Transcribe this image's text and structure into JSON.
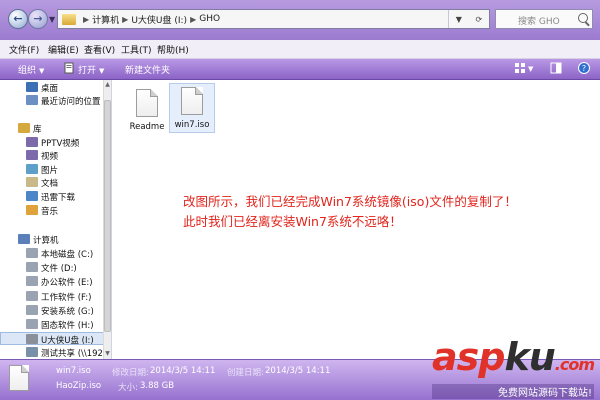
{
  "address": {
    "crumbs": [
      "计算机",
      "U大侠U盘 (I:)",
      "GHO"
    ]
  },
  "search": {
    "placeholder": "搜索 GHO"
  },
  "menu": [
    "文件(F)",
    "编辑(E)",
    "查看(V)",
    "工具(T)",
    "帮助(H)"
  ],
  "toolbar": {
    "organize": "组织",
    "open": "打开",
    "new_folder": "新建文件夹"
  },
  "nav": {
    "items": [
      {
        "label": "桌面",
        "icon": "desktop-icon"
      },
      {
        "label": "最近访问的位置",
        "icon": "recent-places-icon"
      },
      {
        "label": "库",
        "icon": "library-icon"
      },
      {
        "label": "PPTV视频",
        "icon": "video-library-icon"
      },
      {
        "label": "视频",
        "icon": "video-library-icon"
      },
      {
        "label": "图片",
        "icon": "pictures-library-icon"
      },
      {
        "label": "文档",
        "icon": "documents-library-icon"
      },
      {
        "label": "迅雷下载",
        "icon": "download-library-icon"
      },
      {
        "label": "音乐",
        "icon": "music-library-icon"
      },
      {
        "label": "计算机",
        "icon": "computer-icon"
      },
      {
        "label": "本地磁盘 (C:)",
        "icon": "drive-icon"
      },
      {
        "label": "文件 (D:)",
        "icon": "drive-icon"
      },
      {
        "label": "办公软件 (E:)",
        "icon": "drive-icon"
      },
      {
        "label": "工作软件 (F:)",
        "icon": "drive-icon"
      },
      {
        "label": "安装系统 (G:)",
        "icon": "drive-icon"
      },
      {
        "label": "固态软件 (H:)",
        "icon": "drive-icon"
      },
      {
        "label": "U大侠U盘 (I:)",
        "icon": "usb-drive-icon"
      },
      {
        "label": "测试共享 (\\\\192.1",
        "icon": "network-drive-icon"
      }
    ]
  },
  "files": [
    {
      "name": "Readme",
      "icon": "document-icon"
    },
    {
      "name": "win7.iso",
      "icon": "document-icon"
    }
  ],
  "annotation": {
    "line1": "改图所示，我们已经完成Win7系统镜像(iso)文件的复制了！",
    "line2": "此时我们已经离安装Win7系统不远咯！"
  },
  "details": {
    "filename": "win7.iso",
    "modified_label": "修改日期:",
    "modified": "2014/3/5 14:11",
    "created_label": "创建日期:",
    "created": "2014/3/5 14:11",
    "app": "HaoZip.iso",
    "size_label": "大小:",
    "size": "3.88 GB"
  },
  "watermark": {
    "brand_a": "asp",
    "brand_b": "ku",
    "brand_c": ".com",
    "sub": "免费网站源码下载站!"
  },
  "colors": {
    "accent": "#8c64c7",
    "annotation": "#e1241c"
  }
}
